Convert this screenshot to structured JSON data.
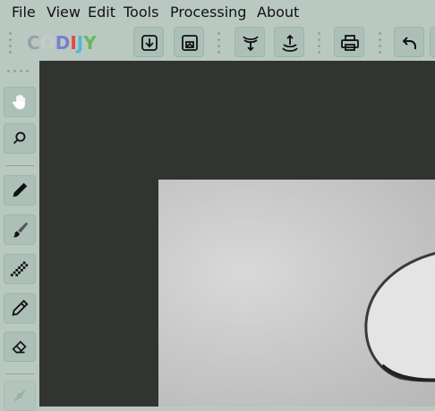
{
  "menu": [
    "File",
    "View",
    "Edit",
    "Tools",
    "Processing",
    "About"
  ],
  "logo": {
    "text": "CODIJY",
    "letters": [
      {
        "ch": "C",
        "color": "#9aa0a6"
      },
      {
        "ch": "O",
        "color": "#c9c9c9"
      },
      {
        "ch": "D",
        "color": "#7a7fc9"
      },
      {
        "ch": "I",
        "color": "#e34b3c"
      },
      {
        "ch": "J",
        "color": "#52b7d6"
      },
      {
        "ch": "Y",
        "color": "#67b85a"
      }
    ]
  },
  "toolbar": {
    "buttons": [
      {
        "name": "open-image-button",
        "icon": "download-arrow-icon"
      },
      {
        "name": "open-picture-button",
        "icon": "picture-frame-icon"
      },
      {
        "name": "import-colors-button",
        "icon": "funnel-down-icon"
      },
      {
        "name": "export-colors-button",
        "icon": "funnel-up-icon"
      },
      {
        "name": "print-button",
        "icon": "printer-icon"
      },
      {
        "name": "undo-button",
        "icon": "undo-arrow-icon"
      }
    ]
  },
  "sidebar": {
    "tools": [
      {
        "name": "hand-tool",
        "icon": "hand-icon"
      },
      {
        "name": "zoom-tool",
        "icon": "magnifier-icon"
      },
      {
        "name": "pencil-tool",
        "icon": "pencil-icon"
      },
      {
        "name": "brush-tool",
        "icon": "brush-icon"
      },
      {
        "name": "dither-brush-tool",
        "icon": "checker-brush-icon"
      },
      {
        "name": "outline-pen-tool",
        "icon": "pen-outline-icon"
      },
      {
        "name": "eraser-tool",
        "icon": "eraser-icon"
      },
      {
        "name": "disabled-tool",
        "icon": "link-icon"
      }
    ]
  },
  "colors": {
    "chrome": "#b9c9c2",
    "canvas": "#323432",
    "button": "#adc0b8"
  }
}
